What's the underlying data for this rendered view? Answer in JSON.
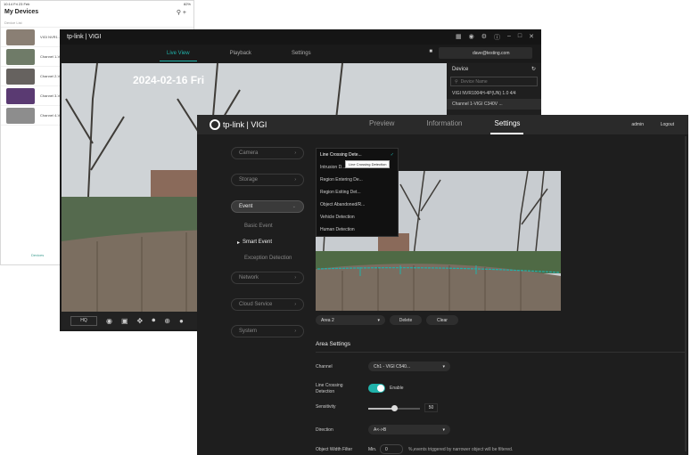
{
  "mobile": {
    "status_time": "10:14 Fri 23 Feb",
    "status_batt": "82%",
    "title": "My Devices",
    "icons": [
      "search-icon",
      "plus-icon"
    ],
    "list_label": "Device List",
    "items": [
      {
        "label": "VIGI NVR1..",
        "thumb": "#8a7f74"
      },
      {
        "label": "Channel 1-VI..",
        "thumb": "#6f7b68"
      },
      {
        "label": "Channel 2-VI..",
        "thumb": "#66625f"
      },
      {
        "label": "Channel 3-VI..",
        "thumb": "#5a3a72"
      },
      {
        "label": "Channel 4-VI..",
        "thumb": "#8d8d8d"
      }
    ],
    "footer": "Devices"
  },
  "desktop": {
    "brand": "tp-link | VIGI",
    "window_controls": [
      "grid-icon",
      "bell-icon",
      "gear-icon",
      "info-icon",
      "minimize-icon",
      "maximize-icon",
      "close-icon"
    ],
    "tabs": [
      {
        "label": "Live View",
        "active": true
      },
      {
        "label": "Playback",
        "active": false
      },
      {
        "label": "Settings",
        "active": false
      }
    ],
    "user": "dave@testing.com",
    "timestamp": "2024-02-16 Fri",
    "device_panel": {
      "title": "Device",
      "search_placeholder": "Device Name",
      "rows": [
        "VIGI NVR1004H-4P(UN) 1.0  4/4",
        "Channel 1-VIGI C340V ..."
      ]
    },
    "toolbar": {
      "quality": "HQ",
      "icons": [
        "camera-icon",
        "record-icon",
        "ptz-icon",
        "mic-icon",
        "zoom-icon",
        "more-icon"
      ]
    }
  },
  "settings": {
    "brand": "tp-link | VIGI",
    "nav": [
      {
        "label": "Preview",
        "active": false
      },
      {
        "label": "Information",
        "active": false
      },
      {
        "label": "Settings",
        "active": true
      }
    ],
    "user": "admin",
    "logout": "Logout",
    "sidebar": {
      "camera": "Camera",
      "storage": "Storage",
      "event": "Event",
      "sub": [
        {
          "label": "Basic Event",
          "active": false
        },
        {
          "label": "Smart Event",
          "active": true
        },
        {
          "label": "Exception Detection",
          "active": false
        }
      ],
      "network": "Network",
      "cloud": "Cloud Service",
      "system": "System"
    },
    "detection_menu": {
      "selected": "Line Crossing Dete...",
      "options": [
        "Intrusion D...",
        "Region Entering De...",
        "Region Exiting Det...",
        "Object Abandoned/R...",
        "Vehicle Detection",
        "Human Detection"
      ],
      "tooltip": "Line Crossing Detection"
    },
    "area": {
      "select": "Area 2",
      "delete": "Delete",
      "clear": "Clear"
    },
    "area_settings": {
      "title": "Area Settings",
      "channel_label": "Channel",
      "channel_value": "Ch1 - VIGI C540...",
      "lcd_label_1": "Line Crossing",
      "lcd_label_2": "Detection",
      "enable_label": "Enable",
      "enabled": true,
      "sensitivity_label": "Sensitivity",
      "sensitivity": 50,
      "direction_label": "Direction",
      "direction_value": "A<->B",
      "filter_label": "Object Width Filter",
      "min_label": "Min.",
      "min_value": "0",
      "filter_note": "%,events triggered by narrower object will be filtered."
    }
  },
  "colors": {
    "accent": "#20b2aa"
  }
}
